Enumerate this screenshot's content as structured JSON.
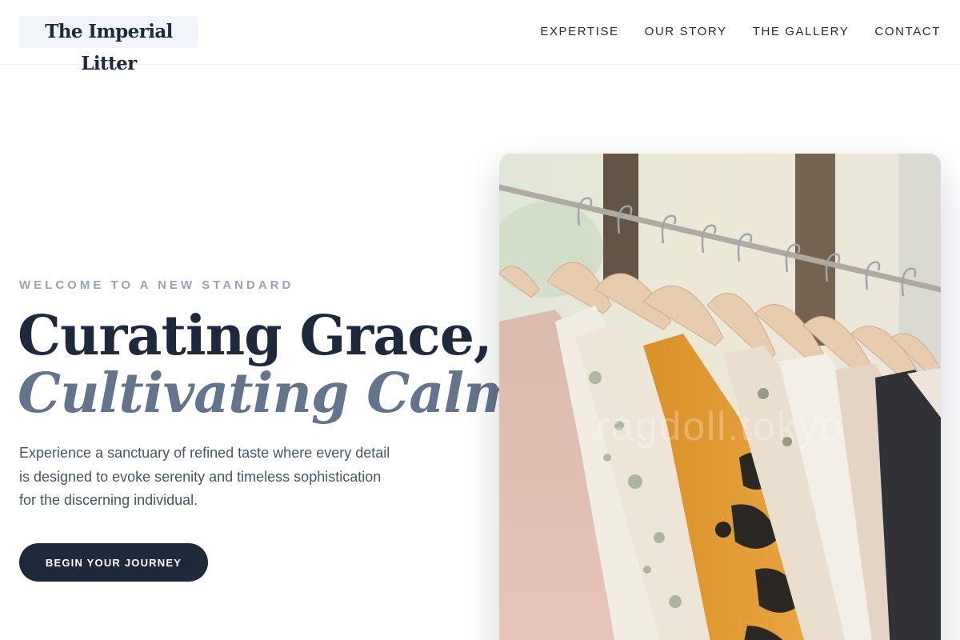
{
  "header": {
    "logo": "The Imperial Litter",
    "nav": [
      "EXPERTISE",
      "OUR STORY",
      "THE GALLERY",
      "CONTACT"
    ]
  },
  "hero": {
    "eyebrow": "WELCOME TO A NEW STANDARD",
    "headline_line1": "Curating Grace,",
    "headline_line2": "Cultivating Calm.",
    "lede": "Experience a sanctuary of refined taste where every detail is designed to evoke serenity and timeless sophistication for the discerning individual.",
    "cta_label": "BEGIN YOUR JOURNEY",
    "image_watermark": "ragdoll.tokyo"
  },
  "colors": {
    "primary": "#1e293b",
    "accent_text": "#64748b",
    "muted": "#94a3b8"
  }
}
